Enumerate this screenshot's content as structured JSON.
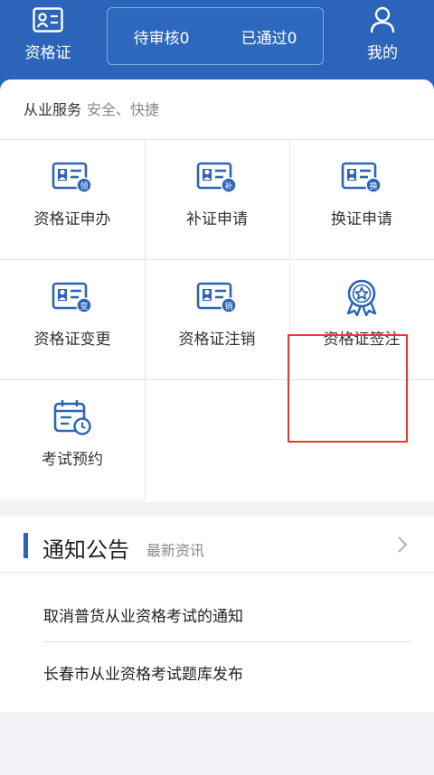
{
  "header": {
    "left_button": {
      "label": "资格证",
      "icon": "id-card-icon"
    },
    "status": {
      "pending": "待审核0",
      "approved": "已通过0"
    },
    "right_button": {
      "label": "我的",
      "icon": "user-icon"
    },
    "bg_color": "#2b64b8"
  },
  "services": {
    "title": "从业服务",
    "subtitle": "安全、快捷",
    "items": [
      {
        "label": "资格证申办",
        "badge": "领",
        "icon": "certificate-apply-icon"
      },
      {
        "label": "补证申请",
        "badge": "补",
        "icon": "certificate-reissue-icon"
      },
      {
        "label": "换证申请",
        "badge": "换",
        "icon": "certificate-renew-icon"
      },
      {
        "label": "资格证变更",
        "badge": "变",
        "icon": "certificate-change-icon"
      },
      {
        "label": "资格证注销",
        "badge": "销",
        "icon": "certificate-cancel-icon"
      },
      {
        "label": "资格证签注",
        "badge": "",
        "icon": "award-badge-icon"
      },
      {
        "label": "考试预约",
        "badge": "",
        "icon": "calendar-clock-icon"
      }
    ]
  },
  "notice": {
    "title": "通知公告",
    "subtitle": "最新资讯",
    "items": [
      "取消普货从业资格考试的通知",
      "长春市从业资格考试题库发布"
    ]
  },
  "accent_color": "#2b64b8",
  "highlight_color": "#e53935"
}
